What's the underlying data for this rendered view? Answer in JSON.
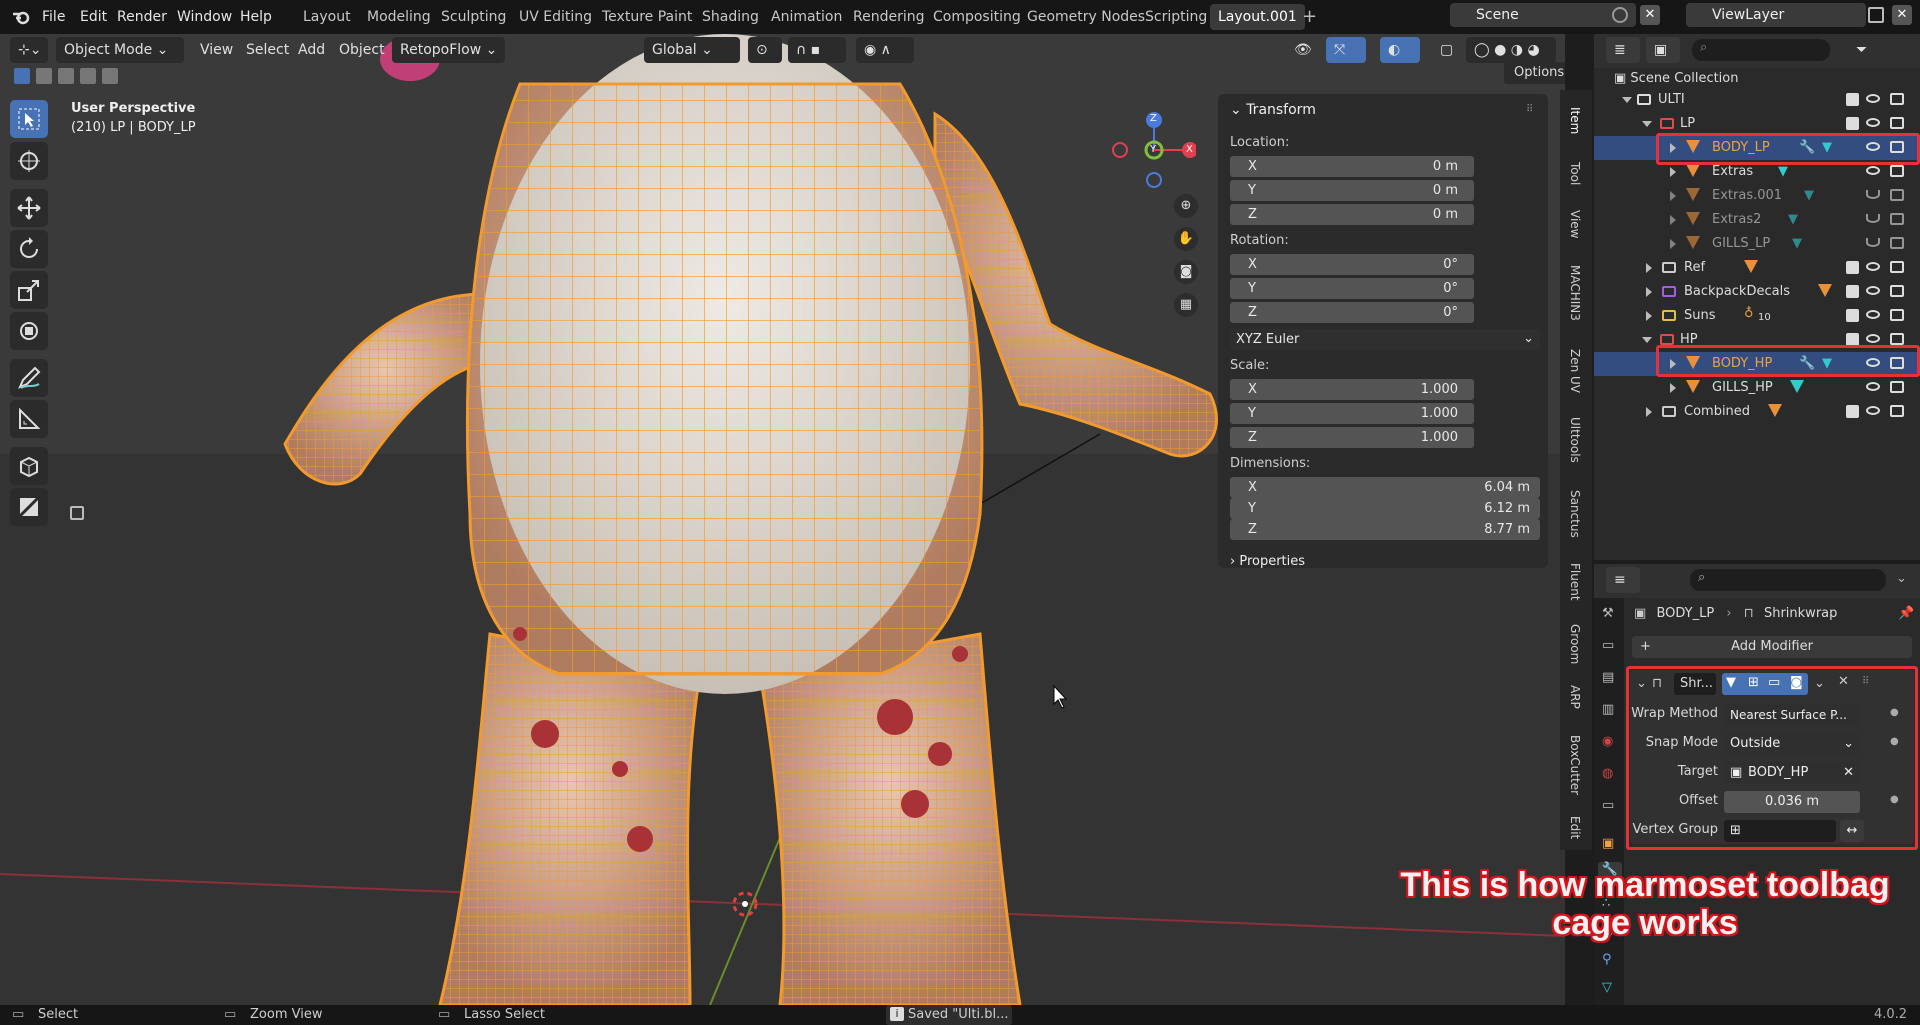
{
  "top_menu": {
    "logo": "blender-logo-icon",
    "items": [
      "File",
      "Edit",
      "Render",
      "Window",
      "Help"
    ],
    "workspaces": [
      "Layout",
      "Modeling",
      "Sculpting",
      "UV Editing",
      "Texture Paint",
      "Shading",
      "Animation",
      "Rendering",
      "Compositing",
      "Geometry Nodes",
      "Scripting",
      "Layout.001"
    ],
    "active_workspace": "Layout.001",
    "scene": "Scene",
    "view_layer": "ViewLayer"
  },
  "viewport_header": {
    "mode": "Object Mode",
    "menus": [
      "View",
      "Select",
      "Add",
      "Object"
    ],
    "addon": "RetopoFlow",
    "orientation": "Global",
    "options": "Options"
  },
  "viewport": {
    "perspective": "User Perspective",
    "object_info": "(210) LP | BODY_LP",
    "gizmo_axes": [
      "Z",
      "Y",
      "X"
    ]
  },
  "npanel": {
    "transform_title": "Transform",
    "location_label": "Location:",
    "location": [
      {
        "axis": "X",
        "value": "0 m"
      },
      {
        "axis": "Y",
        "value": "0 m"
      },
      {
        "axis": "Z",
        "value": "0 m"
      }
    ],
    "rotation_label": "Rotation:",
    "rotation": [
      {
        "axis": "X",
        "value": "0°"
      },
      {
        "axis": "Y",
        "value": "0°"
      },
      {
        "axis": "Z",
        "value": "0°"
      }
    ],
    "rotation_mode": "XYZ Euler",
    "scale_label": "Scale:",
    "scale": [
      {
        "axis": "X",
        "value": "1.000"
      },
      {
        "axis": "Y",
        "value": "1.000"
      },
      {
        "axis": "Z",
        "value": "1.000"
      }
    ],
    "dimensions_label": "Dimensions:",
    "dimensions": [
      {
        "axis": "X",
        "value": "6.04 m"
      },
      {
        "axis": "Y",
        "value": "6.12 m"
      },
      {
        "axis": "Z",
        "value": "8.77 m"
      }
    ],
    "properties_title": "Properties"
  },
  "sidebar_tabs": [
    "Item",
    "Tool",
    "View",
    "MACHIN3",
    "Zen UV",
    "Ulttools",
    "Sanctus",
    "Fluent",
    "Groom",
    "ARP",
    "BoxCutter",
    "Edit"
  ],
  "outliner": {
    "root": "Scene Collection",
    "rows": [
      {
        "label": "ULTI",
        "kind": "collection"
      },
      {
        "label": "LP",
        "kind": "collection"
      },
      {
        "label": "BODY_LP",
        "kind": "mesh",
        "selected": true
      },
      {
        "label": "Extras",
        "kind": "mesh"
      },
      {
        "label": "Extras.001",
        "kind": "mesh"
      },
      {
        "label": "Extras2",
        "kind": "mesh"
      },
      {
        "label": "GILLS_LP",
        "kind": "mesh"
      },
      {
        "label": "Ref",
        "kind": "collection"
      },
      {
        "label": "BackpackDecals",
        "kind": "collection"
      },
      {
        "label": "Suns",
        "kind": "collection",
        "badge": "10"
      },
      {
        "label": "HP",
        "kind": "collection"
      },
      {
        "label": "BODY_HP",
        "kind": "mesh",
        "selected": true
      },
      {
        "label": "GILLS_HP",
        "kind": "mesh"
      },
      {
        "label": "Combined",
        "kind": "collection"
      }
    ]
  },
  "properties": {
    "breadcrumb_object": "BODY_LP",
    "breadcrumb_modifier": "Shrinkwrap",
    "add_modifier": "Add Modifier",
    "modifier_name": "Shr...",
    "wrap_method_label": "Wrap Method",
    "wrap_method": "Nearest Surface P...",
    "snap_mode_label": "Snap Mode",
    "snap_mode": "Outside",
    "target_label": "Target",
    "target": "BODY_HP",
    "offset_label": "Offset",
    "offset": "0.036 m",
    "vertex_group_label": "Vertex Group"
  },
  "status": {
    "select": "Select",
    "zoom": "Zoom View",
    "lasso": "Lasso Select",
    "message": "Saved \"Ulti.bl...",
    "version": "4.0.2"
  },
  "annotation": "This is how marmoset toolbag cage works",
  "colors": {
    "accent": "#4772b3",
    "selection_outline": "#f29a2e",
    "highlight_box": "#e8303a"
  }
}
